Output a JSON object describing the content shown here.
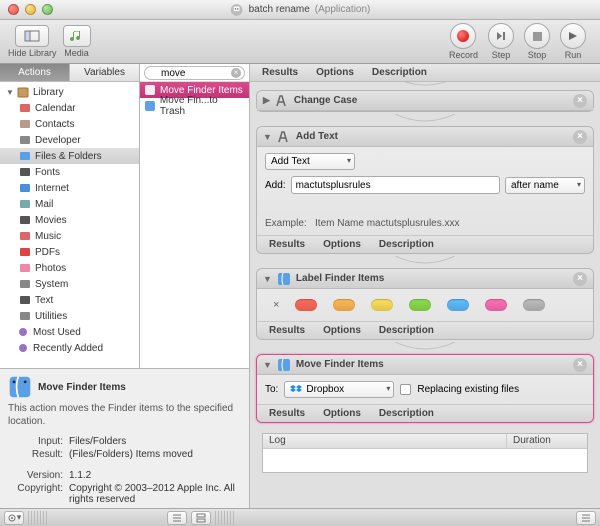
{
  "title": {
    "name": "batch rename",
    "type": "(Application)"
  },
  "toolbar": {
    "hideLibrary": "Hide Library",
    "media": "Media",
    "record": "Record",
    "step": "Step",
    "stop": "Stop",
    "run": "Run"
  },
  "sidebarTabs": {
    "actions": "Actions",
    "variables": "Variables"
  },
  "library": {
    "root": "Library",
    "items": [
      "Calendar",
      "Contacts",
      "Developer",
      "Files & Folders",
      "Fonts",
      "Internet",
      "Mail",
      "Movies",
      "Music",
      "PDFs",
      "Photos",
      "System",
      "Text",
      "Utilities"
    ],
    "selected": "Files & Folders",
    "mostUsed": "Most Used",
    "recentlyAdded": "Recently Added"
  },
  "search": {
    "value": "move",
    "placeholder": "Search"
  },
  "results": [
    {
      "label": "Move Finder Items",
      "selected": true
    },
    {
      "label": "Move Fin...to Trash",
      "selected": false
    }
  ],
  "columnHeader": {
    "results": "Results",
    "options": "Options",
    "description": "Description"
  },
  "actions": {
    "changeCase": {
      "title": "Change Case"
    },
    "addText": {
      "title": "Add Text",
      "mode": "Add Text",
      "addLabel": "Add:",
      "addValue": "mactutsplusrules",
      "position": "after name",
      "exampleLabel": "Example:",
      "exampleValue": "Item Name mactutsplusrules.xxx"
    },
    "labelFinder": {
      "title": "Label Finder Items",
      "colors": [
        "#ff6b5d",
        "#ffb958",
        "#ffe15a",
        "#8dde4e",
        "#5fbdff",
        "#ff6fb8",
        "#bdbdbd"
      ]
    },
    "moveFinder": {
      "title": "Move Finder Items",
      "toLabel": "To:",
      "destination": "Dropbox",
      "replaceLabel": "Replacing existing files"
    }
  },
  "log": {
    "logCol": "Log",
    "durationCol": "Duration"
  },
  "info": {
    "title": "Move Finder Items",
    "desc": "This action moves the Finder items to the specified location.",
    "input_k": "Input:",
    "input_v": "Files/Folders",
    "result_k": "Result:",
    "result_v": "(Files/Folders) Items moved",
    "version_k": "Version:",
    "version_v": "1.1.2",
    "copyright_k": "Copyright:",
    "copyright_v": "Copyright © 2003–2012 Apple Inc. All rights reserved"
  }
}
